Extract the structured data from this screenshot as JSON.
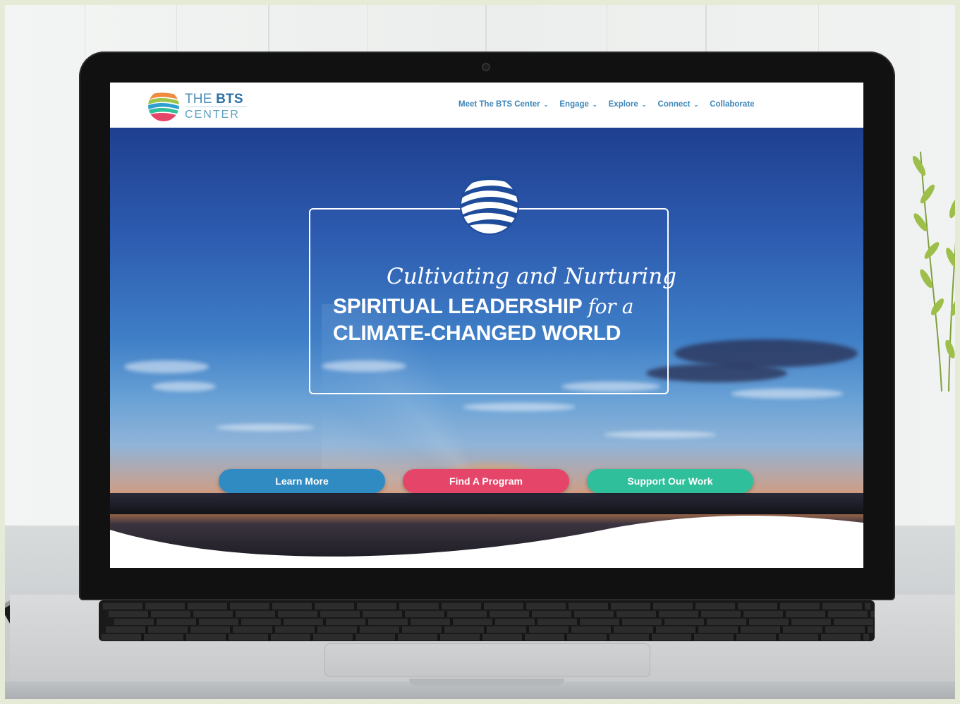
{
  "site": {
    "logo": {
      "word_the": "THE",
      "word_bts": "BTS",
      "word_center": "CENTER"
    },
    "nav": [
      {
        "label": "Meet The BTS Center",
        "has_dropdown": true
      },
      {
        "label": "Engage",
        "has_dropdown": true
      },
      {
        "label": "Explore",
        "has_dropdown": true
      },
      {
        "label": "Connect",
        "has_dropdown": true
      },
      {
        "label": "Collaborate",
        "has_dropdown": false
      }
    ],
    "hero": {
      "script_line": "Cultivating and Nurturing",
      "main_line_1": "SPIRITUAL LEADERSHIP",
      "inline_script": "for a",
      "main_line_2": "CLIMATE-CHANGED WORLD"
    },
    "buttons": {
      "learn_more": "Learn More",
      "find_program": "Find A Program",
      "support": "Support Our Work"
    },
    "colors": {
      "nav_text": "#3d86b8",
      "learn_more": "#2f8bc2",
      "find_program": "#e6456a",
      "support": "#2fbf9a"
    }
  }
}
